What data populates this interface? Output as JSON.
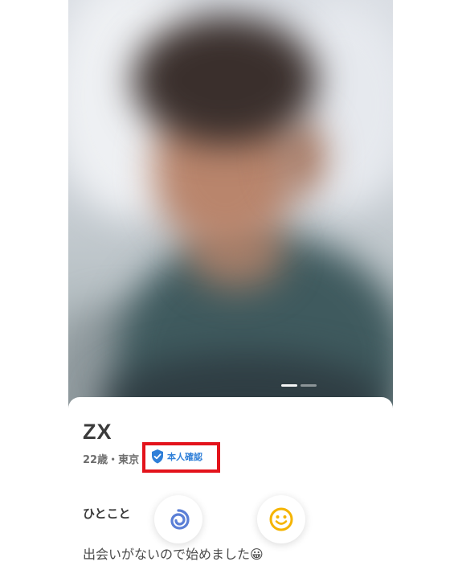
{
  "profile": {
    "name": "ZX",
    "meta": "22歳・東京",
    "verified_label": "本人確認",
    "photo_count": 2,
    "photo_index": 1
  },
  "section": {
    "title": "ひとこと",
    "bio_text": "出会いがないので始めました😀"
  },
  "actions": {
    "skip_icon": "swirl-icon",
    "like_icon": "smile-icon"
  },
  "colors": {
    "highlight_border": "#e3131b",
    "verified_blue": "#2f7fd8",
    "swirl_blue": "#5b7fd6",
    "smile_yellow": "#f5b400"
  }
}
